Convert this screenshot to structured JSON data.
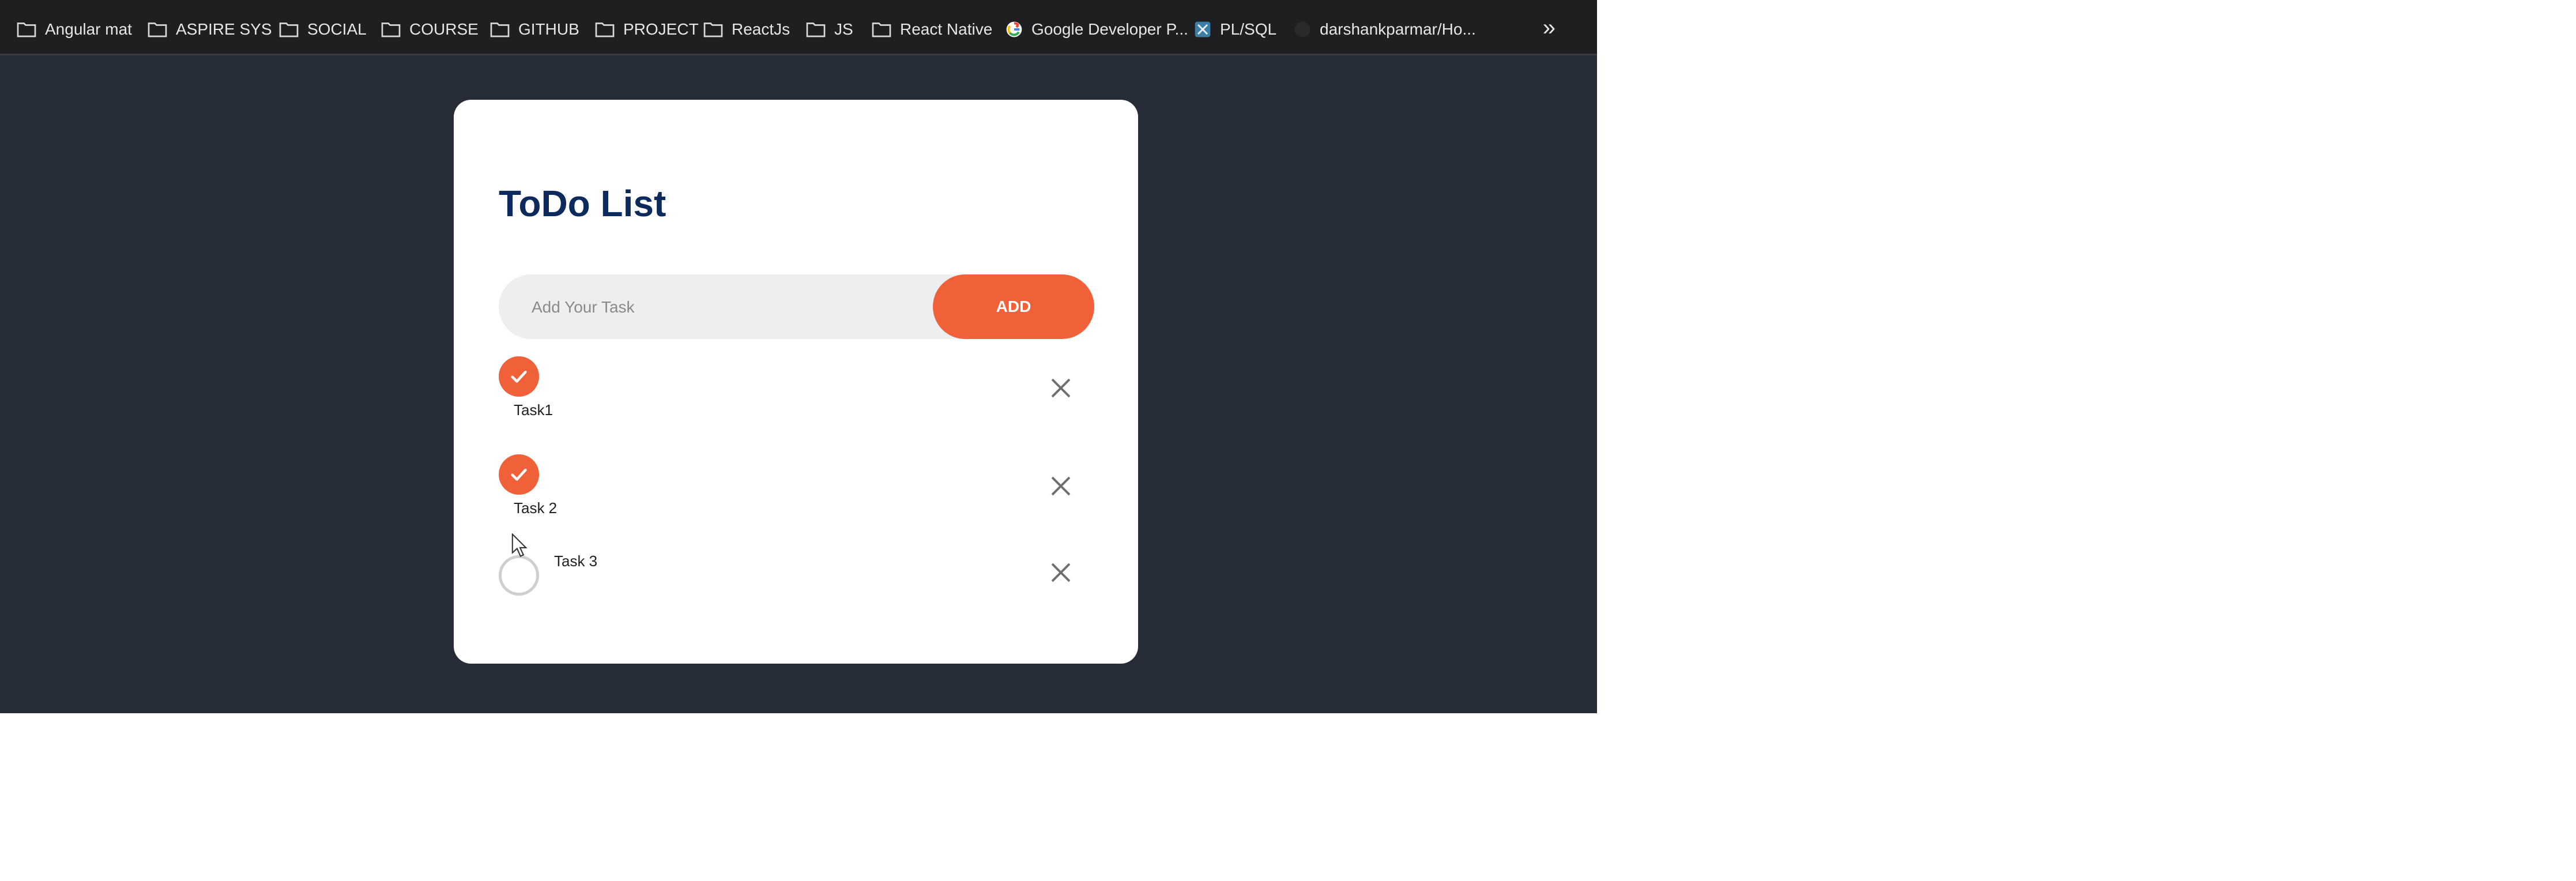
{
  "bookmarks": [
    {
      "label": "Angular mat",
      "icon": "folder-icon"
    },
    {
      "label": "ASPIRE SYS",
      "icon": "folder-icon"
    },
    {
      "label": "SOCIAL",
      "icon": "folder-icon"
    },
    {
      "label": "COURSE",
      "icon": "folder-icon"
    },
    {
      "label": "GITHUB",
      "icon": "folder-icon"
    },
    {
      "label": "PROJECT",
      "icon": "folder-icon"
    },
    {
      "label": "ReactJs",
      "icon": "folder-icon"
    },
    {
      "label": "JS",
      "icon": "folder-icon"
    },
    {
      "label": "React Native",
      "icon": "folder-icon"
    },
    {
      "label": "Google Developer P...",
      "icon": "google-icon"
    },
    {
      "label": "PL/SQL",
      "icon": "plsql-icon"
    },
    {
      "label": "darshankparmar/Ho...",
      "icon": "github-icon"
    }
  ],
  "overflow_chevron": "»",
  "todo": {
    "title": "ToDo List",
    "input_placeholder": "Add Your Task",
    "input_value": "",
    "add_label": "ADD",
    "tasks": [
      {
        "label": "Task1",
        "checked": true
      },
      {
        "label": "Task 2",
        "checked": true
      },
      {
        "label": "Task 3",
        "checked": false
      }
    ]
  },
  "colors": {
    "accent": "#f0613a",
    "title": "#0d2a5c",
    "background": "#262c38",
    "bookmarks_bar": "#1f1f21"
  }
}
